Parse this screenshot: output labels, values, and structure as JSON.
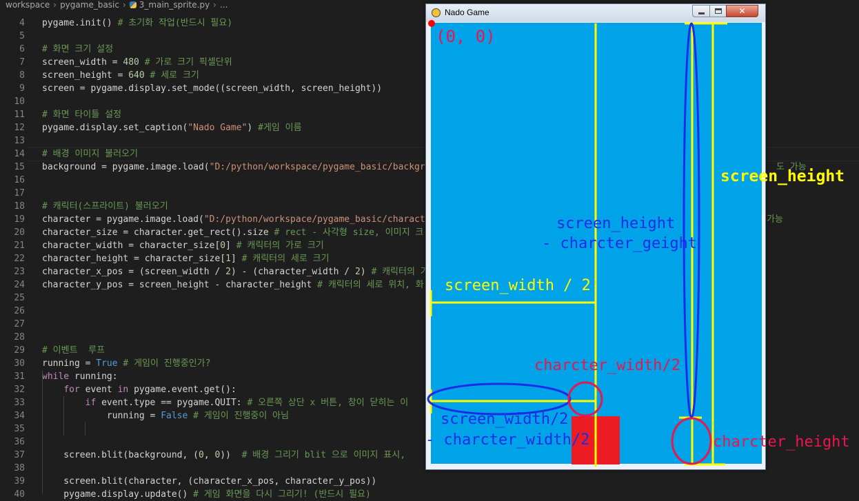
{
  "breadcrumb": {
    "items": [
      "workspace",
      "pygame_basic",
      "3_main_sprite.py",
      "..."
    ]
  },
  "editor": {
    "lines": [
      {
        "n": "4",
        "tokens": [
          [
            "t",
            "pygame.init() "
          ],
          [
            "cm",
            "# 초기화 작업(반드시 필요)"
          ]
        ]
      },
      {
        "n": "5",
        "tokens": []
      },
      {
        "n": "6",
        "tokens": [
          [
            "cm",
            "# 화면 크기 설정"
          ]
        ]
      },
      {
        "n": "7",
        "tokens": [
          [
            "t",
            "screen_width = "
          ],
          [
            "num",
            "480"
          ],
          [
            "cm",
            " # 가로 크기 픽셀단위"
          ]
        ]
      },
      {
        "n": "8",
        "tokens": [
          [
            "t",
            "screen_height = "
          ],
          [
            "num",
            "640"
          ],
          [
            "cm",
            " # 세로 크기"
          ]
        ]
      },
      {
        "n": "9",
        "tokens": [
          [
            "t",
            "screen = pygame.display.set_mode((screen_width, screen_height))"
          ]
        ]
      },
      {
        "n": "10",
        "tokens": []
      },
      {
        "n": "11",
        "tokens": [
          [
            "cm",
            "# 화면 타이틀 설정"
          ]
        ]
      },
      {
        "n": "12",
        "tokens": [
          [
            "t",
            "pygame.display.set_caption("
          ],
          [
            "str",
            "\"Nado Game\""
          ],
          [
            "t",
            ") "
          ],
          [
            "cm",
            "#게임 이름"
          ]
        ]
      },
      {
        "n": "13",
        "tokens": []
      },
      {
        "n": "14",
        "tokens": [
          [
            "cm",
            "# 배경 이미지 불러오기"
          ]
        ]
      },
      {
        "n": "15",
        "tokens": [
          [
            "t",
            "background = pygame.image.load("
          ],
          [
            "str",
            "\"D:/python/workspace/pygame_basic/backgro"
          ]
        ]
      },
      {
        "n": "16",
        "tokens": []
      },
      {
        "n": "17",
        "tokens": []
      },
      {
        "n": "18",
        "tokens": [
          [
            "cm",
            "# 캐릭터(스프라이트) 불러오기"
          ]
        ]
      },
      {
        "n": "19",
        "tokens": [
          [
            "t",
            "character = pygame.image.load("
          ],
          [
            "str",
            "\"D:/python/workspace/pygame_basic/characte"
          ]
        ]
      },
      {
        "n": "20",
        "tokens": [
          [
            "t",
            "character_size = character.get_rect().size "
          ],
          [
            "cm",
            "# rect - 사각형 size, 이미지 크"
          ]
        ]
      },
      {
        "n": "21",
        "tokens": [
          [
            "t",
            "character_width = character_size["
          ],
          [
            "num",
            "0"
          ],
          [
            "t",
            "] "
          ],
          [
            "cm",
            "# 캐릭터의 가로 크기"
          ]
        ]
      },
      {
        "n": "22",
        "tokens": [
          [
            "t",
            "character_height = character_size["
          ],
          [
            "num",
            "1"
          ],
          [
            "t",
            "] "
          ],
          [
            "cm",
            "# 캐릭터의 세로 크기"
          ]
        ]
      },
      {
        "n": "23",
        "tokens": [
          [
            "t",
            "character_x_pos = (screen_width / "
          ],
          [
            "num",
            "2"
          ],
          [
            "t",
            ") - (character_width / "
          ],
          [
            "num",
            "2"
          ],
          [
            "t",
            ") "
          ],
          [
            "cm",
            "# 캐릭터의 가"
          ]
        ]
      },
      {
        "n": "24",
        "tokens": [
          [
            "t",
            "character_y_pos = screen_height - character_height "
          ],
          [
            "cm",
            "# 캐릭터의 세로 위치, 화"
          ]
        ]
      },
      {
        "n": "25",
        "tokens": []
      },
      {
        "n": "26",
        "tokens": []
      },
      {
        "n": "27",
        "tokens": []
      },
      {
        "n": "28",
        "tokens": []
      },
      {
        "n": "29",
        "tokens": [
          [
            "cm",
            "# 이벤트  루프"
          ]
        ]
      },
      {
        "n": "30",
        "tokens": [
          [
            "t",
            "running = "
          ],
          [
            "const",
            "True"
          ],
          [
            "cm",
            " # 게임이 진행중인가?"
          ]
        ]
      },
      {
        "n": "31",
        "tokens": [
          [
            "kw",
            "while"
          ],
          [
            "t",
            " running:"
          ]
        ]
      },
      {
        "n": "32",
        "tokens": [
          [
            "t",
            "    "
          ],
          [
            "kw",
            "for"
          ],
          [
            "t",
            " event "
          ],
          [
            "kw",
            "in"
          ],
          [
            "t",
            " pygame.event.get():"
          ]
        ]
      },
      {
        "n": "33",
        "tokens": [
          [
            "t",
            "        "
          ],
          [
            "kw",
            "if"
          ],
          [
            "t",
            " event.type == pygame.QUIT: "
          ],
          [
            "cm",
            "# 오른쪽 상단 x 버튼, 창이 닫히는 이"
          ]
        ]
      },
      {
        "n": "34",
        "tokens": [
          [
            "t",
            "            running = "
          ],
          [
            "const",
            "False"
          ],
          [
            "cm",
            " # 게임이 진행중이 아님"
          ]
        ]
      },
      {
        "n": "35",
        "tokens": []
      },
      {
        "n": "36",
        "tokens": []
      },
      {
        "n": "37",
        "tokens": [
          [
            "t",
            "    screen.blit(background, ("
          ],
          [
            "num",
            "0"
          ],
          [
            "t",
            ", "
          ],
          [
            "num",
            "0"
          ],
          [
            "t",
            "))  "
          ],
          [
            "cm",
            "# 배경 그리기 blit 으로 이미지 표시,"
          ]
        ]
      },
      {
        "n": "38",
        "tokens": []
      },
      {
        "n": "39",
        "tokens": [
          [
            "t",
            "    screen.blit(character, (character_x_pos, character_y_pos))"
          ]
        ]
      },
      {
        "n": "40",
        "tokens": [
          [
            "t",
            "    pygame.display.update() "
          ],
          [
            "cm",
            "# 게임 화면을 다시 그리기! (반드시 필요)"
          ]
        ]
      }
    ],
    "right_overflow": {
      "line15": "도 가능",
      "line19": "가능"
    }
  },
  "window": {
    "title": "Nado Game",
    "close_glyph": "✕"
  },
  "annotations": {
    "origin": "(0, 0)",
    "screen_height": "screen_height",
    "screen_height_minus_1": "screen_height",
    "screen_height_minus_2": "- charcter_geight",
    "screen_width_half": "screen_width / 2",
    "character_width_half": "charcter_width/2",
    "sw_minus_cw_1": "screen_width/2",
    "sw_minus_cw_2": "- charcter_width/2",
    "character_height": "charcter_height"
  },
  "colors": {
    "sky": "#00a2e8",
    "character": "#ed1c24",
    "yellow": "#ffff00",
    "blue": "#1a2ee8",
    "pink": "#e8174f",
    "red_dot": "#ff0000"
  },
  "icons": [
    "python-file-icon",
    "pygame-icon",
    "minimize-icon",
    "maximize-icon",
    "close-icon"
  ]
}
